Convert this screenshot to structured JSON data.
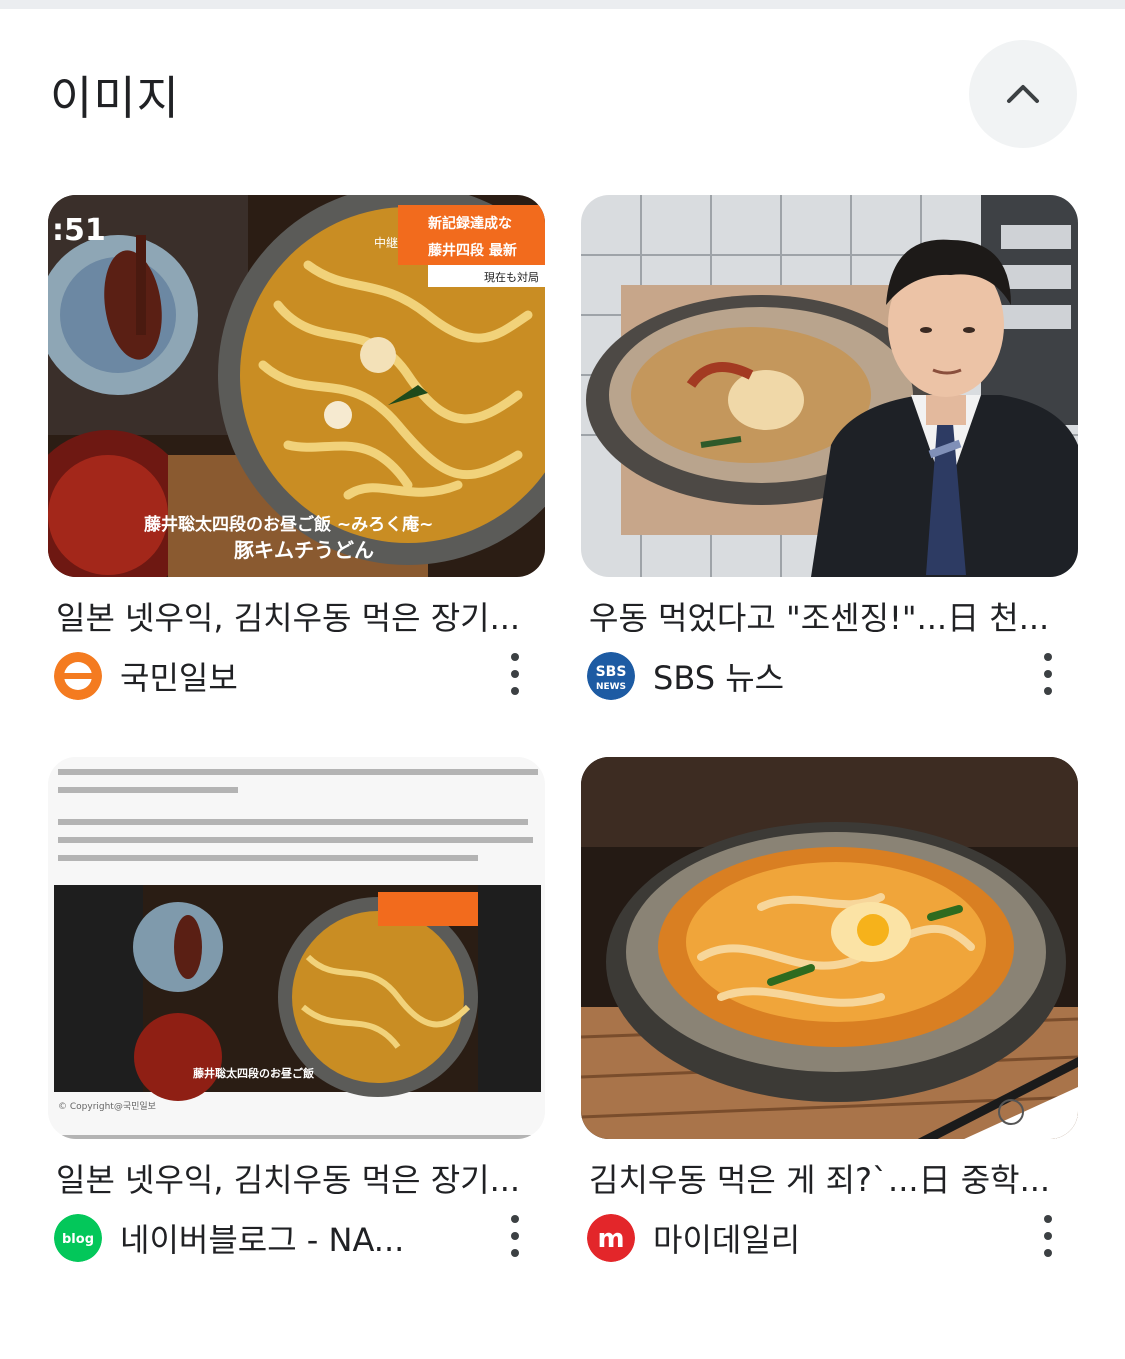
{
  "section": {
    "title": "이미지",
    "collapse_icon": "chevron-up-icon"
  },
  "results": [
    {
      "title": "일본 넷우익, 김치우동 먹은 장기...",
      "source": "국민일보",
      "source_icon": "kukmin-ilbo-logo-icon",
      "thumb_text": [
        "藤井聡太四段のお昼ご飯 ~みろく庵~",
        "豚キムチうどん",
        "新記録達成な",
        "藤井四段 最新",
        "現在も対局",
        "中継"
      ]
    },
    {
      "title": "우동 먹었다고 \"조센징!\"...日 천...",
      "source": "SBS 뉴스",
      "source_icon": "sbs-news-logo-icon",
      "thumb_text": []
    },
    {
      "title": "일본 넷우익, 김치우동 먹은 장기...",
      "source": "네이버블로그 - NA...",
      "source_icon": "naver-blog-logo-icon",
      "thumb_text": [
        "© Copyright@국민일보"
      ]
    },
    {
      "title": "김치우동 먹은 게 죄?`...日 중학...",
      "source": "마이데일리",
      "source_icon": "mydaily-logo-icon",
      "thumb_text": []
    }
  ],
  "colors": {
    "accent_kukmin": "#f47b20",
    "accent_sbs": "#1d5ba3",
    "accent_naver": "#03c75a",
    "accent_mydaily": "#e3262a"
  }
}
